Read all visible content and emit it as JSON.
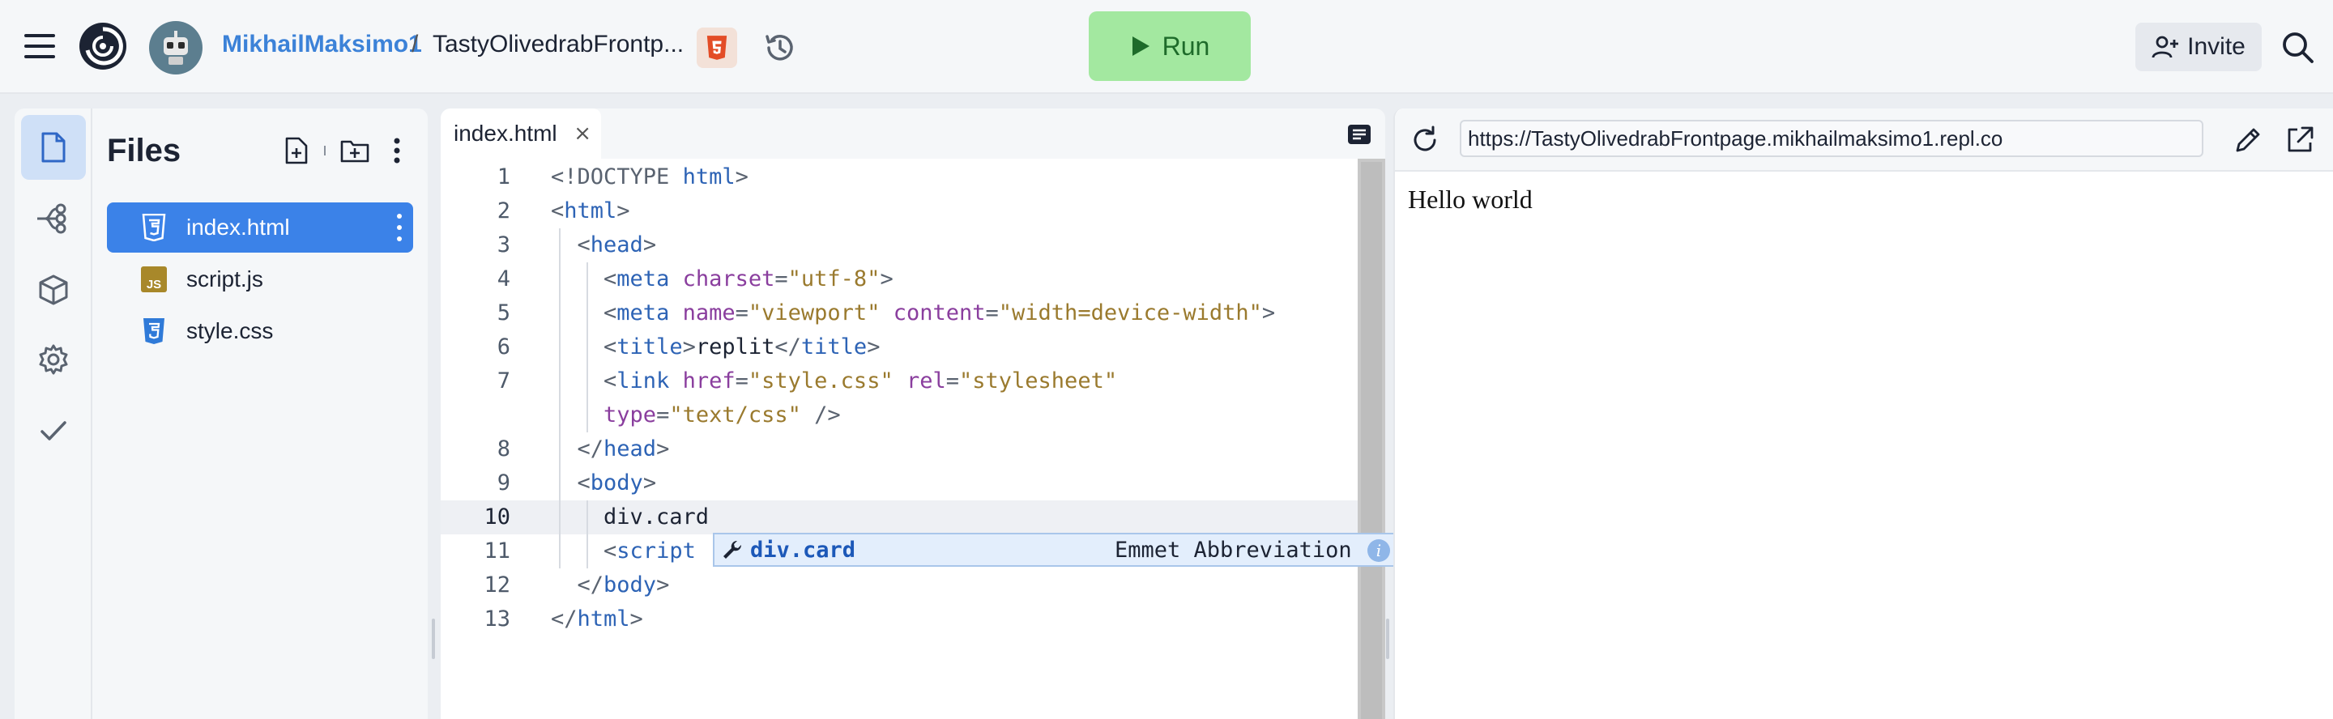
{
  "header": {
    "menu_icon": "hamburger-menu-icon",
    "logo_icon": "replit-logo-icon",
    "owner": "MikhailMaksimo1",
    "separator": "/",
    "repl_name": "TastyOlivedrabFrontp...",
    "language_icon": "html5-icon",
    "history_icon": "history-icon",
    "run_label": "Run",
    "invite_label": "Invite",
    "search_icon": "search-icon"
  },
  "activity_bar": {
    "items": [
      {
        "name": "files",
        "icon": "file-icon",
        "active": true
      },
      {
        "name": "git",
        "icon": "git-branch-icon",
        "active": false
      },
      {
        "name": "packages",
        "icon": "package-cube-icon",
        "active": false
      },
      {
        "name": "settings",
        "icon": "gear-icon",
        "active": false
      },
      {
        "name": "checks",
        "icon": "check-icon",
        "active": false
      }
    ]
  },
  "files_panel": {
    "title": "Files",
    "actions": [
      "new-file-icon",
      "new-folder-icon",
      "more-vertical-icon"
    ],
    "files": [
      {
        "name": "index.html",
        "icon": "css-html-badge-icon",
        "active": true
      },
      {
        "name": "script.js",
        "icon": "js-badge-icon",
        "active": false
      },
      {
        "name": "style.css",
        "icon": "css-badge-icon",
        "active": false
      }
    ]
  },
  "editor": {
    "tab": {
      "label": "index.html",
      "close": "×"
    },
    "lines": [
      {
        "n": "1",
        "tokens": [
          [
            "t-doctype",
            "<!DOCTYPE "
          ],
          [
            "t-tag",
            "html"
          ],
          [
            "t-doctype",
            ">"
          ]
        ]
      },
      {
        "n": "2",
        "tokens": [
          [
            "t-punct",
            "<"
          ],
          [
            "t-tag",
            "html"
          ],
          [
            "t-punct",
            ">"
          ]
        ]
      },
      {
        "n": "3",
        "tokens": [
          [
            "t-text",
            "  "
          ],
          [
            "t-punct",
            "<"
          ],
          [
            "t-tag",
            "head"
          ],
          [
            "t-punct",
            ">"
          ]
        ]
      },
      {
        "n": "4",
        "tokens": [
          [
            "t-text",
            "    "
          ],
          [
            "t-punct",
            "<"
          ],
          [
            "t-tag",
            "meta"
          ],
          [
            "t-text",
            " "
          ],
          [
            "t-attr",
            "charset"
          ],
          [
            "t-punct",
            "="
          ],
          [
            "t-str",
            "\"utf-8\""
          ],
          [
            "t-punct",
            ">"
          ]
        ]
      },
      {
        "n": "5",
        "tokens": [
          [
            "t-text",
            "    "
          ],
          [
            "t-punct",
            "<"
          ],
          [
            "t-tag",
            "meta"
          ],
          [
            "t-text",
            " "
          ],
          [
            "t-attr",
            "name"
          ],
          [
            "t-punct",
            "="
          ],
          [
            "t-str",
            "\"viewport\""
          ],
          [
            "t-text",
            " "
          ],
          [
            "t-attr",
            "content"
          ],
          [
            "t-punct",
            "="
          ],
          [
            "t-str",
            "\"width=device-width\""
          ],
          [
            "t-punct",
            ">"
          ]
        ]
      },
      {
        "n": "6",
        "tokens": [
          [
            "t-text",
            "    "
          ],
          [
            "t-punct",
            "<"
          ],
          [
            "t-tag",
            "title"
          ],
          [
            "t-punct",
            ">"
          ],
          [
            "t-text",
            "replit"
          ],
          [
            "t-punct",
            "</"
          ],
          [
            "t-tag",
            "title"
          ],
          [
            "t-punct",
            ">"
          ]
        ]
      },
      {
        "n": "7",
        "tokens": [
          [
            "t-text",
            "    "
          ],
          [
            "t-punct",
            "<"
          ],
          [
            "t-tag",
            "link"
          ],
          [
            "t-text",
            " "
          ],
          [
            "t-attr",
            "href"
          ],
          [
            "t-punct",
            "="
          ],
          [
            "t-str",
            "\"style.css\""
          ],
          [
            "t-text",
            " "
          ],
          [
            "t-attr",
            "rel"
          ],
          [
            "t-punct",
            "="
          ],
          [
            "t-str",
            "\"stylesheet\""
          ]
        ]
      },
      {
        "n": "",
        "tokens": [
          [
            "t-text",
            "    "
          ],
          [
            "t-attr",
            "type"
          ],
          [
            "t-punct",
            "="
          ],
          [
            "t-str",
            "\"text/css\""
          ],
          [
            "t-text",
            " "
          ],
          [
            "t-punct",
            "/>"
          ]
        ]
      },
      {
        "n": "8",
        "tokens": [
          [
            "t-text",
            "  "
          ],
          [
            "t-punct",
            "</"
          ],
          [
            "t-tag",
            "head"
          ],
          [
            "t-punct",
            ">"
          ]
        ]
      },
      {
        "n": "9",
        "tokens": [
          [
            "t-text",
            "  "
          ],
          [
            "t-punct",
            "<"
          ],
          [
            "t-tag",
            "body"
          ],
          [
            "t-punct",
            ">"
          ]
        ]
      },
      {
        "n": "10",
        "tokens": [
          [
            "t-text",
            "    div.card"
          ]
        ],
        "current": true
      },
      {
        "n": "11",
        "tokens": [
          [
            "t-text",
            "    "
          ],
          [
            "t-punct",
            "<"
          ],
          [
            "t-tag",
            "script"
          ]
        ]
      },
      {
        "n": "12",
        "tokens": [
          [
            "t-text",
            "  "
          ],
          [
            "t-punct",
            "</"
          ],
          [
            "t-tag",
            "body"
          ],
          [
            "t-punct",
            ">"
          ]
        ]
      },
      {
        "n": "13",
        "tokens": [
          [
            "t-punct",
            "</"
          ],
          [
            "t-tag",
            "html"
          ],
          [
            "t-punct",
            ">"
          ]
        ]
      }
    ],
    "suggestion": {
      "label": "div.card",
      "detail": "Emmet Abbreviation",
      "icon": "wrench-icon",
      "info": "i"
    }
  },
  "webview": {
    "url": "https://TastyOlivedrabFrontpage.mikhailmaksimo1.repl.co",
    "content": "Hello world"
  }
}
